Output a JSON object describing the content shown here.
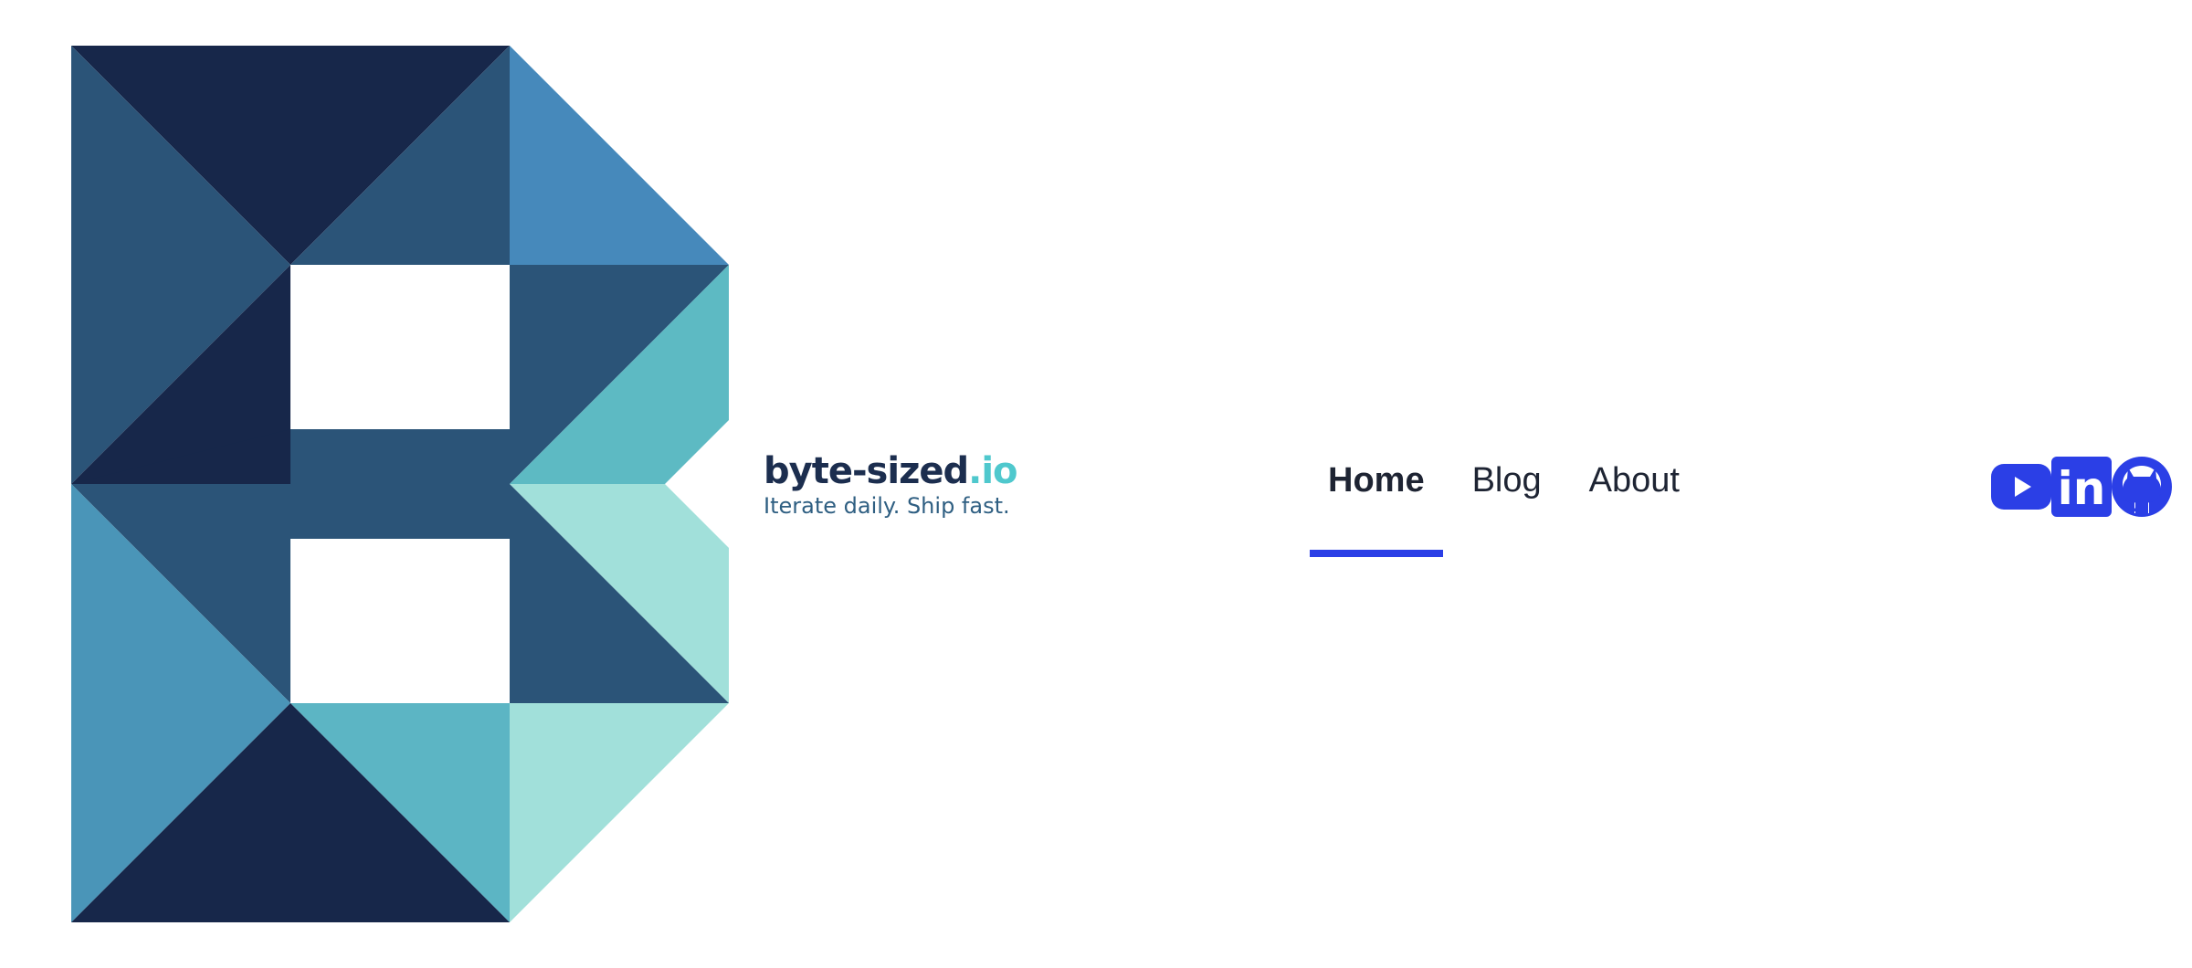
{
  "brand": {
    "name_main": "byte-sized",
    "name_tld": ".io",
    "tagline": "Iterate daily. Ship fast."
  },
  "nav": {
    "items": [
      {
        "label": "Home",
        "active": true
      },
      {
        "label": "Blog",
        "active": false
      },
      {
        "label": "About",
        "active": false
      }
    ]
  },
  "social": {
    "items": [
      {
        "icon": "youtube-icon"
      },
      {
        "icon": "linkedin-icon",
        "text": "in"
      },
      {
        "icon": "github-icon"
      }
    ]
  },
  "colors": {
    "accent": "#2b3fe6",
    "brand_dark": "#1c2e4f",
    "brand_teal": "#4fc8cd",
    "tagline": "#2f5f82",
    "nav_text": "#1e2433"
  }
}
